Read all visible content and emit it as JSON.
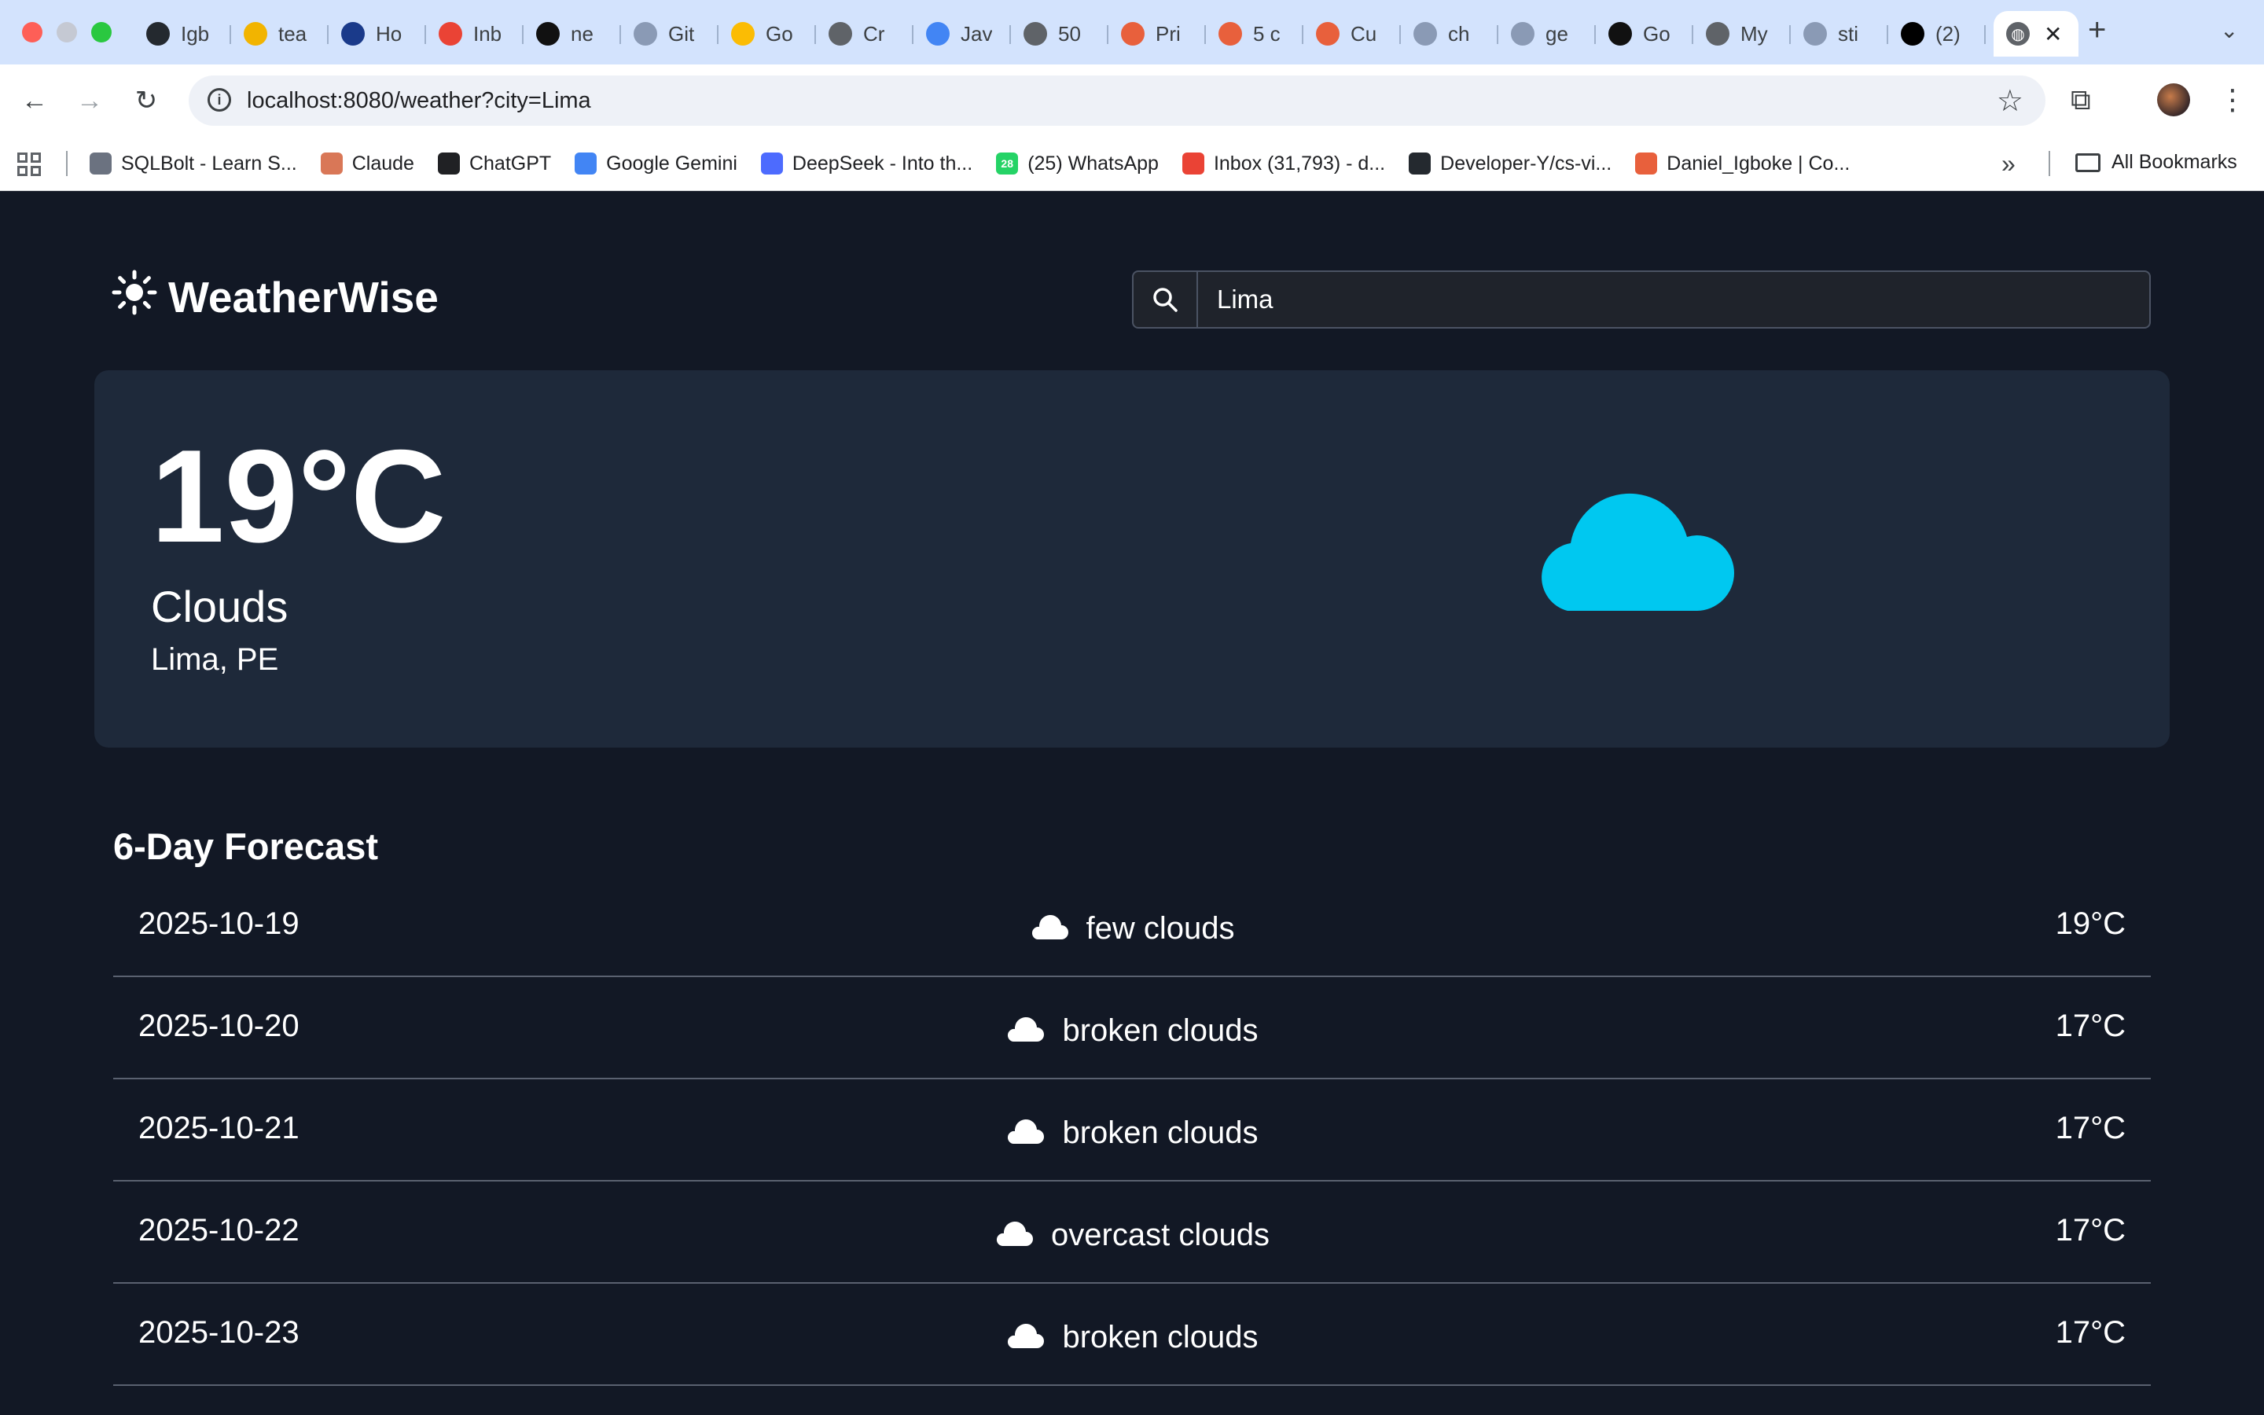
{
  "browser": {
    "tabs": [
      {
        "title": "Igb",
        "icon": "github-icon",
        "color": "#24292f"
      },
      {
        "title": "tea",
        "icon": "key-icon",
        "color": "#f2b400"
      },
      {
        "title": "Ho",
        "icon": "p-icon",
        "color": "#1a3a8a"
      },
      {
        "title": "Inb",
        "icon": "gmail-icon",
        "color": "#ea4335"
      },
      {
        "title": "ne",
        "icon": "medium-icon",
        "color": "#111111"
      },
      {
        "title": "Git",
        "icon": "globe-outline-icon",
        "color": "#8a9ab5"
      },
      {
        "title": "Go",
        "icon": "bulb-icon",
        "color": "#fbbc04"
      },
      {
        "title": "Cr",
        "icon": "globe-icon",
        "color": "#5f6368"
      },
      {
        "title": "Jav",
        "icon": "doc-icon",
        "color": "#4285f4"
      },
      {
        "title": "50",
        "icon": "globe-icon",
        "color": "#5f6368"
      },
      {
        "title": "Pri",
        "icon": "burst-icon",
        "color": "#e8603c"
      },
      {
        "title": "5 c",
        "icon": "burst-icon",
        "color": "#e8603c"
      },
      {
        "title": "Cu",
        "icon": "burst-icon",
        "color": "#e8603c"
      },
      {
        "title": "ch",
        "icon": "spark-icon",
        "color": "#8a9ab5"
      },
      {
        "title": "ge",
        "icon": "spark-icon",
        "color": "#8a9ab5"
      },
      {
        "title": "Go",
        "icon": "box-icon",
        "color": "#111111"
      },
      {
        "title": "My",
        "icon": "globe-icon",
        "color": "#5f6368"
      },
      {
        "title": "sti",
        "icon": "triangle-icon",
        "color": "#8a9ab5"
      },
      {
        "title": "(2)",
        "icon": "x-icon",
        "color": "#000000"
      }
    ],
    "url": "localhost:8080/weather?city=Lima",
    "bookmarks": [
      {
        "label": "SQLBolt - Learn S...",
        "icon": "database-icon",
        "color": "#6b7280"
      },
      {
        "label": "Claude",
        "icon": "claude-icon",
        "color": "#d97757"
      },
      {
        "label": "ChatGPT",
        "icon": "chatgpt-icon",
        "color": "#202124"
      },
      {
        "label": "Google Gemini",
        "icon": "gemini-icon",
        "color": "#4285f4"
      },
      {
        "label": "DeepSeek - Into th...",
        "icon": "deepseek-icon",
        "color": "#4d6bfe"
      },
      {
        "label": "(25) WhatsApp",
        "icon": "whatsapp-icon",
        "color": "#25d366",
        "badge": "28"
      },
      {
        "label": "Inbox (31,793) - d...",
        "icon": "gmail-icon",
        "color": "#ea4335"
      },
      {
        "label": "Developer-Y/cs-vi...",
        "icon": "github-icon",
        "color": "#24292f"
      },
      {
        "label": "Daniel_Igboke | Co...",
        "icon": "portfolio-icon",
        "color": "#e8603c"
      }
    ],
    "all_bookmarks_label": "All Bookmarks"
  },
  "app": {
    "brand": "WeatherWise",
    "search": {
      "value": "Lima",
      "placeholder": ""
    }
  },
  "current": {
    "temp": "19°C",
    "condition": "Clouds",
    "location": "Lima, PE",
    "icon": "cloud-icon",
    "icon_color": "#00c8f0"
  },
  "forecast": {
    "title": "6-Day Forecast",
    "days": [
      {
        "date": "2025-10-19",
        "desc": "few clouds",
        "temp": "19°C"
      },
      {
        "date": "2025-10-20",
        "desc": "broken clouds",
        "temp": "17°C"
      },
      {
        "date": "2025-10-21",
        "desc": "broken clouds",
        "temp": "17°C"
      },
      {
        "date": "2025-10-22",
        "desc": "overcast clouds",
        "temp": "17°C"
      },
      {
        "date": "2025-10-23",
        "desc": "broken clouds",
        "temp": "17°C"
      }
    ]
  }
}
